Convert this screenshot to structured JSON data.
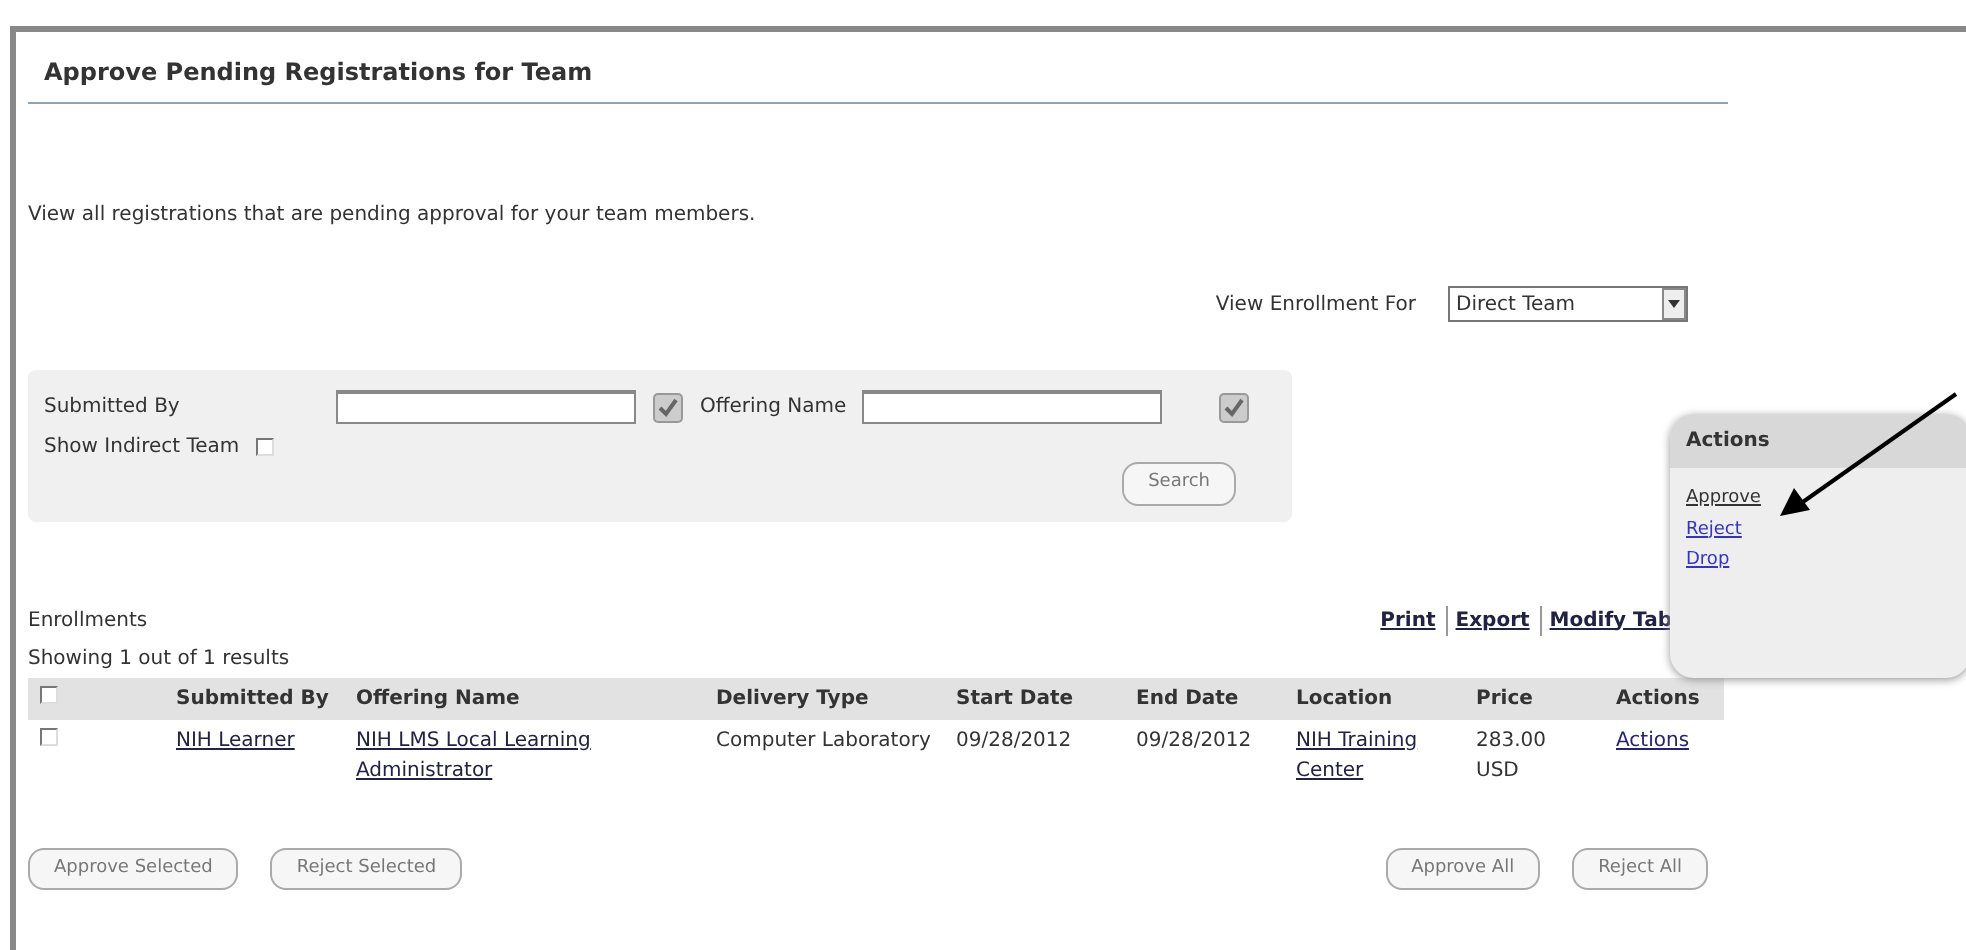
{
  "title": "Approve Pending Registrations for Team",
  "description": "View all registrations that are pending approval for your team members.",
  "view_for": {
    "label": "View Enrollment For",
    "value": "Direct Team"
  },
  "filters": {
    "submitted_by": {
      "label": "Submitted By"
    },
    "offering_name": {
      "label": "Offering Name"
    },
    "show_indirect": {
      "label": "Show Indirect Team",
      "checked": false
    },
    "search_button": "Search"
  },
  "enrollments": {
    "title": "Enrollments",
    "showing": "Showing 1 out of 1 results",
    "links": [
      "Print",
      "Export",
      "Modify Tab"
    ],
    "columns": [
      "Submitted By",
      "Offering Name",
      "Delivery Type",
      "Start Date",
      "End Date",
      "Location",
      "Price",
      "Actions"
    ],
    "header_checked": false,
    "rows": [
      {
        "checked": false,
        "cells": [
          "NIH Learner",
          "NIH LMS Local Learning Administrator",
          "Computer Laboratory",
          "09/28/2012",
          "09/28/2012",
          "NIH Training Center",
          "283.00 USD",
          "Actions"
        ]
      }
    ]
  },
  "buttons_left": [
    "Approve Selected",
    "Reject Selected"
  ],
  "buttons_right": [
    "Approve All",
    "Reject All"
  ],
  "actions_popup": {
    "title": "Actions",
    "items": [
      {
        "label": "Approve",
        "visited": true
      },
      {
        "label": "Reject",
        "visited": false
      },
      {
        "label": "Drop",
        "visited": false
      }
    ]
  }
}
